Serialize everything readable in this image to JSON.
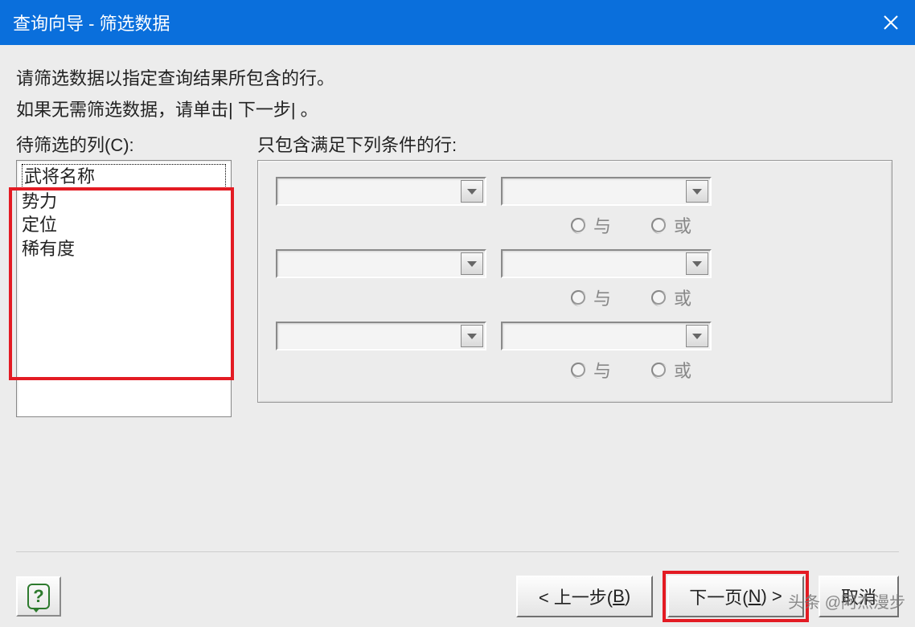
{
  "title": "查询向导 - 筛选数据",
  "instructions": {
    "line1": "请筛选数据以指定查询结果所包含的行。",
    "line2": "如果无需筛选数据，请单击| 下一步| 。"
  },
  "labels": {
    "columnsToFilter": "待筛选的列(C):",
    "conditions": "只包含满足下列条件的行:"
  },
  "columns": [
    "武将名称",
    "势力",
    "定位",
    "稀有度"
  ],
  "radio": {
    "and": "与",
    "or": "或"
  },
  "buttons": {
    "back": "< 上一步(",
    "backKey": "B",
    "backEnd": ")",
    "next": "下一页(",
    "nextKey": "N",
    "nextEnd": ") >",
    "cancel": "取消"
  },
  "help": "?",
  "watermark": "头条 @阿杰漫步"
}
